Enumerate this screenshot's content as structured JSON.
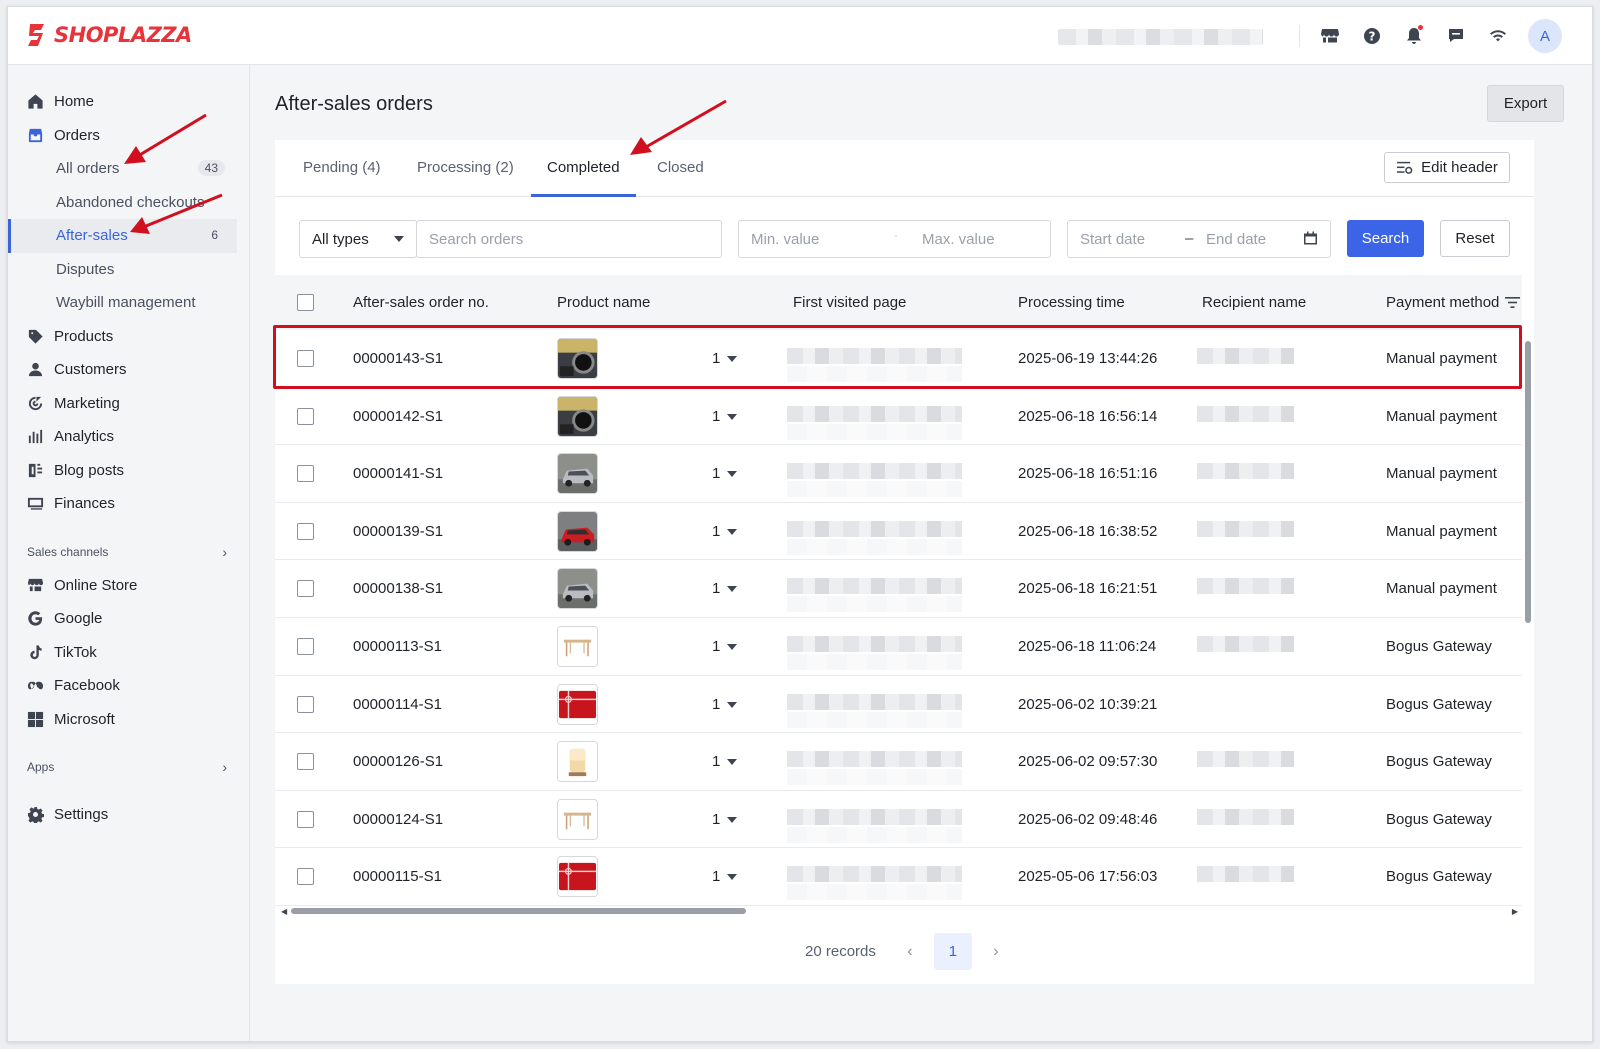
{
  "app": {
    "brand": "SHOPLAZZA",
    "brand_color": "#e8333a",
    "accent_color": "#3b64d6"
  },
  "topbar": {
    "avatar_initial": "A",
    "icons": [
      "store-icon",
      "help-icon",
      "bell-icon",
      "chat-icon",
      "wifi-icon"
    ]
  },
  "sidebar": {
    "home": "Home",
    "orders": "Orders",
    "all_orders": "All orders",
    "all_orders_count": "43",
    "abandoned": "Abandoned checkouts",
    "after_sales": "After-sales",
    "after_sales_count": "6",
    "disputes": "Disputes",
    "waybill": "Waybill management",
    "products": "Products",
    "customers": "Customers",
    "marketing": "Marketing",
    "analytics": "Analytics",
    "blog": "Blog posts",
    "finances": "Finances",
    "sales_channels": "Sales channels",
    "online_store": "Online Store",
    "google": "Google",
    "tiktok": "TikTok",
    "facebook": "Facebook",
    "microsoft": "Microsoft",
    "apps": "Apps",
    "settings": "Settings"
  },
  "page": {
    "title": "After-sales orders",
    "export": "Export",
    "edit_header": "Edit header"
  },
  "tabs": [
    "Pending (4)",
    "Processing (2)",
    "Completed",
    "Closed"
  ],
  "active_tab": "Completed",
  "filters": {
    "type": "All types",
    "search_placeholder": "Search orders",
    "min_placeholder": "Min. value",
    "max_placeholder": "Max. value",
    "start_placeholder": "Start date",
    "end_placeholder": "End date",
    "search_btn": "Search",
    "reset_btn": "Reset"
  },
  "table": {
    "headers": [
      "After-sales order no.",
      "Product name",
      "First visited page",
      "Processing time",
      "Recipient name",
      "Payment method"
    ],
    "rows": [
      {
        "no": "00000143-S1",
        "qty": "1",
        "time": "2025-06-19 13:44:26",
        "payment": "Manual payment",
        "thumb": "car-interior"
      },
      {
        "no": "00000142-S1",
        "qty": "1",
        "time": "2025-06-18 16:56:14",
        "payment": "Manual payment",
        "thumb": "car-interior"
      },
      {
        "no": "00000141-S1",
        "qty": "1",
        "time": "2025-06-18 16:51:16",
        "payment": "Manual payment",
        "thumb": "car-silver"
      },
      {
        "no": "00000139-S1",
        "qty": "1",
        "time": "2025-06-18 16:38:52",
        "payment": "Manual payment",
        "thumb": "car-red"
      },
      {
        "no": "00000138-S1",
        "qty": "1",
        "time": "2025-06-18 16:21:51",
        "payment": "Manual payment",
        "thumb": "car-silver"
      },
      {
        "no": "00000113-S1",
        "qty": "1",
        "time": "2025-06-18 11:06:24",
        "payment": "Bogus Gateway",
        "thumb": "table"
      },
      {
        "no": "00000114-S1",
        "qty": "1",
        "time": "2025-06-02 10:39:21",
        "payment": "Bogus Gateway",
        "thumb": "gift-card"
      },
      {
        "no": "00000126-S1",
        "qty": "1",
        "time": "2025-06-02 09:57:30",
        "payment": "Bogus Gateway",
        "thumb": "lamp"
      },
      {
        "no": "00000124-S1",
        "qty": "1",
        "time": "2025-06-02 09:48:46",
        "payment": "Bogus Gateway",
        "thumb": "table"
      },
      {
        "no": "00000115-S1",
        "qty": "1",
        "time": "2025-05-06 17:56:03",
        "payment": "Bogus Gateway",
        "thumb": "gift-card"
      }
    ]
  },
  "pagination": {
    "records": "20 records",
    "current_page": "1"
  }
}
